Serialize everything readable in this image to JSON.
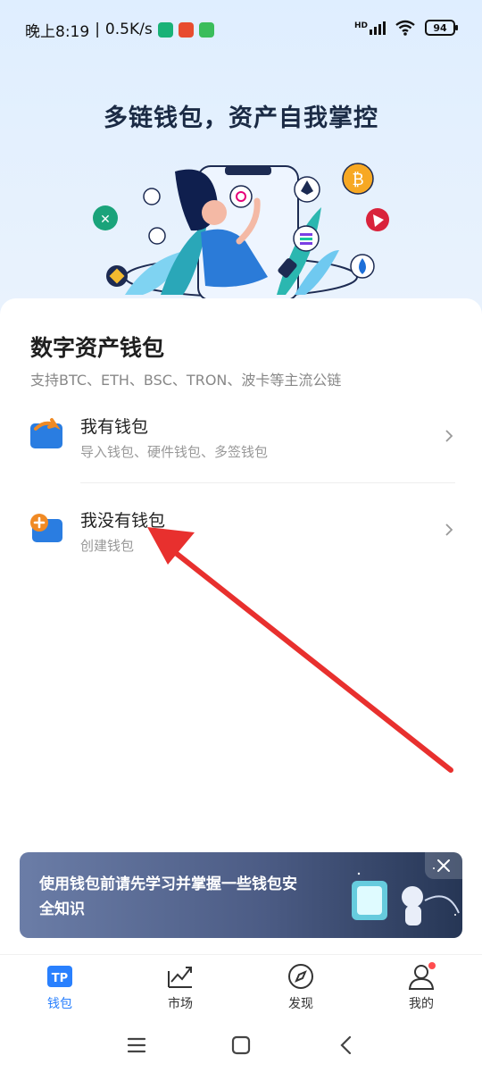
{
  "status_bar": {
    "time": "晚上8:19",
    "speed": "0.5K/s",
    "network": "HD",
    "battery": "94"
  },
  "hero": {
    "title": "多链钱包，资产自我掌控"
  },
  "wallet_card": {
    "title": "数字资产钱包",
    "subtitle": "支持BTC、ETH、BSC、TRON、波卡等主流公链",
    "options": [
      {
        "title": "我有钱包",
        "desc": "导入钱包、硬件钱包、多签钱包",
        "icon": "import-wallet-icon"
      },
      {
        "title": "我没有钱包",
        "desc": "创建钱包",
        "icon": "create-wallet-icon"
      }
    ]
  },
  "banner": {
    "text": "使用钱包前请先学习并掌握一些钱包安全知识"
  },
  "bottom_nav": [
    {
      "label": "钱包",
      "icon": "tp-wallet-icon",
      "active": true
    },
    {
      "label": "市场",
      "icon": "market-chart-icon"
    },
    {
      "label": "发现",
      "icon": "compass-icon"
    },
    {
      "label": "我的",
      "icon": "profile-icon"
    }
  ],
  "colors": {
    "accent": "#2980fe",
    "wallet_icon_blue": "#2a7de1",
    "wallet_icon_orange": "#f08a24",
    "annotation_arrow": "#e8302e"
  }
}
